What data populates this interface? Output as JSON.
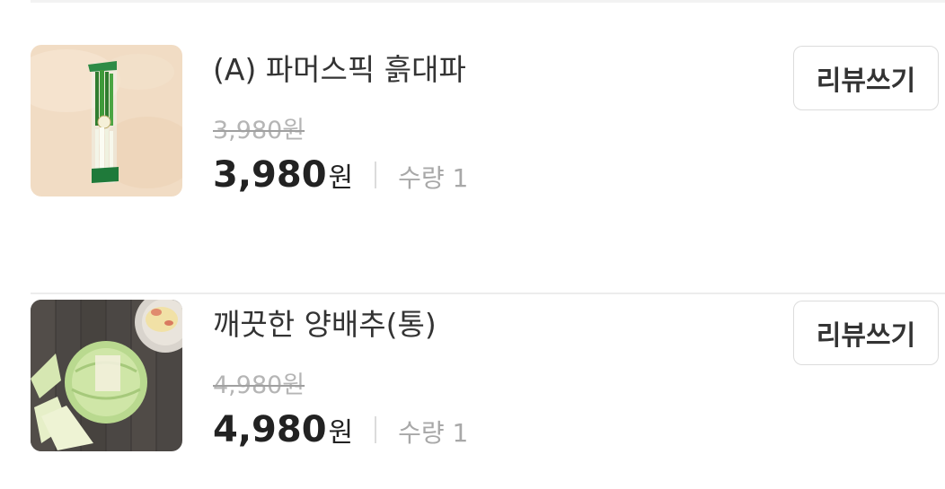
{
  "items": [
    {
      "name": "(A) 파머스픽 흙대파",
      "original_price": "3,980원",
      "price": "3,980",
      "price_unit": "원",
      "quantity": "수량 1",
      "review_button": "리뷰쓰기",
      "image": "green-onion-product-image"
    },
    {
      "name": "깨끗한 양배추(통)",
      "original_price": "4,980원",
      "price": "4,980",
      "price_unit": "원",
      "quantity": "수량 1",
      "review_button": "리뷰쓰기",
      "image": "cabbage-product-image"
    }
  ]
}
